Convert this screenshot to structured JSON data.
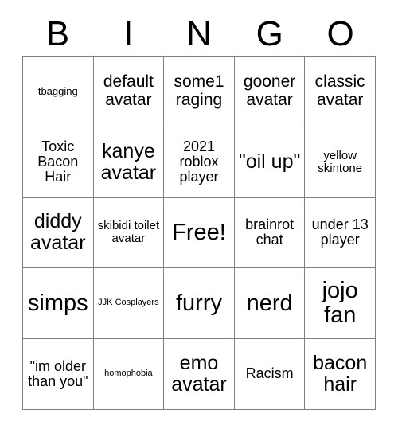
{
  "card": {
    "header_letters": [
      "B",
      "I",
      "N",
      "G",
      "O"
    ],
    "rows": [
      [
        {
          "text": "tbagging",
          "size": "xs"
        },
        {
          "text": "default avatar",
          "size": "lg"
        },
        {
          "text": "some1 raging",
          "size": "lg"
        },
        {
          "text": "gooner avatar",
          "size": "lg"
        },
        {
          "text": "classic avatar",
          "size": "lg"
        }
      ],
      [
        {
          "text": "Toxic Bacon Hair",
          "size": "md"
        },
        {
          "text": "kanye avatar",
          "size": "xl"
        },
        {
          "text": "2021 roblox player",
          "size": "md"
        },
        {
          "text": "\"oil up\"",
          "size": "xl"
        },
        {
          "text": "yellow skintone",
          "size": "sm"
        }
      ],
      [
        {
          "text": "diddy avatar",
          "size": "xl"
        },
        {
          "text": "skibidi toilet avatar",
          "size": "sm"
        },
        {
          "text": "Free!",
          "size": "xxl"
        },
        {
          "text": "brainrot chat",
          "size": "md"
        },
        {
          "text": "under 13 player",
          "size": "md"
        }
      ],
      [
        {
          "text": "simps",
          "size": "xxl"
        },
        {
          "text": "JJK Cosplayers",
          "size": "xxs"
        },
        {
          "text": "furry",
          "size": "xxl"
        },
        {
          "text": "nerd",
          "size": "xxl"
        },
        {
          "text": "jojo fan",
          "size": "xxl"
        }
      ],
      [
        {
          "text": "\"im older than you\"",
          "size": "md"
        },
        {
          "text": "homophobia",
          "size": "xxs"
        },
        {
          "text": "emo avatar",
          "size": "xl"
        },
        {
          "text": "Racism",
          "size": "md"
        },
        {
          "text": "bacon hair",
          "size": "xl"
        }
      ]
    ]
  },
  "colors": {
    "background": "#ffffff",
    "text": "#000000",
    "grid_line": "#808080"
  }
}
